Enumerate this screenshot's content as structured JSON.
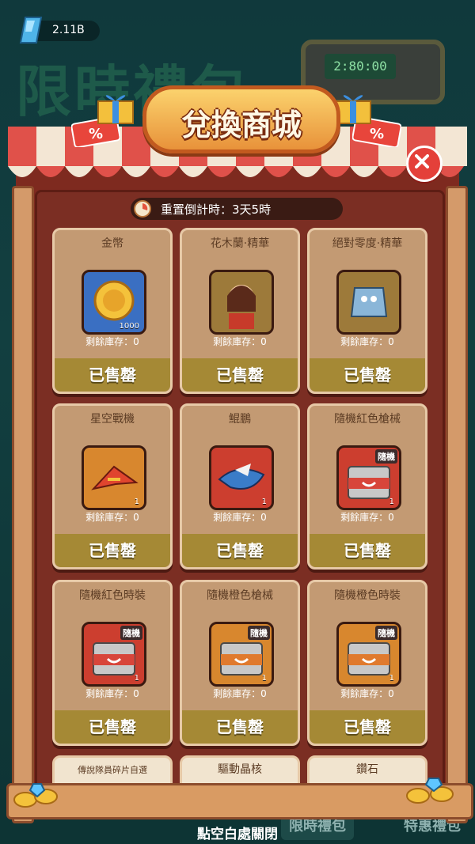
{
  "currency": {
    "value": "2.11B",
    "icon": "crystal-icon"
  },
  "background": {
    "title": "限時禮包",
    "timer": "2:80:00"
  },
  "shop": {
    "title": "兌換商城",
    "reset_label": "重置倒計時：3天5時",
    "items": [
      {
        "name": "金幣",
        "qty": "1000",
        "stock": "剩餘庫存：0",
        "status": "已售罄",
        "icon": "gold-coin-icon",
        "color": "#3a6fc2"
      },
      {
        "name": "花木蘭·精華",
        "qty": "",
        "stock": "剩餘庫存：0",
        "status": "已售罄",
        "icon": "mulan-portrait-icon",
        "color": "#9d7a3a"
      },
      {
        "name": "絕對零度·精華",
        "qty": "",
        "stock": "剩餘庫存：0",
        "status": "已售罄",
        "icon": "mech-portrait-icon",
        "color": "#9d7a3a"
      },
      {
        "name": "星空戰機",
        "qty": "1",
        "stock": "剩餘庫存：0",
        "status": "已售罄",
        "icon": "starfighter-icon",
        "color": "#d8872e"
      },
      {
        "name": "鯤鵬",
        "qty": "1",
        "stock": "剩餘庫存：0",
        "status": "已售罄",
        "icon": "kunpeng-icon",
        "color": "#cc3e2f"
      },
      {
        "name": "隨機紅色槍械",
        "qty": "1",
        "stock": "剩餘庫存：0",
        "status": "已售罄",
        "icon": "red-chest-icon",
        "color": "#cc3e2f",
        "tag": "隨機"
      },
      {
        "name": "隨機紅色時裝",
        "qty": "1",
        "stock": "剩餘庫存：0",
        "status": "已售罄",
        "icon": "red-chest-icon",
        "color": "#cc3e2f",
        "tag": "隨機"
      },
      {
        "name": "隨機橙色槍械",
        "qty": "1",
        "stock": "剩餘庫存：0",
        "status": "已售罄",
        "icon": "orange-chest-icon",
        "color": "#d8872e",
        "tag": "隨機"
      },
      {
        "name": "隨機橙色時裝",
        "qty": "1",
        "stock": "剩餘庫存：0",
        "status": "已售罄",
        "icon": "orange-chest-icon",
        "color": "#d8872e",
        "tag": "隨機"
      }
    ],
    "partial_items": [
      {
        "name": "傳說隊員碎片自選"
      },
      {
        "name": "驅動晶核"
      },
      {
        "name": "鑽石"
      }
    ]
  },
  "footer": {
    "close_hint": "點空白處關閉",
    "tab_limited": "限時禮包",
    "tab_special": "特惠禮包"
  },
  "colors": {
    "frame": "#7e2a1f",
    "sold_banner": "#a58935",
    "close": "#e4403a"
  }
}
